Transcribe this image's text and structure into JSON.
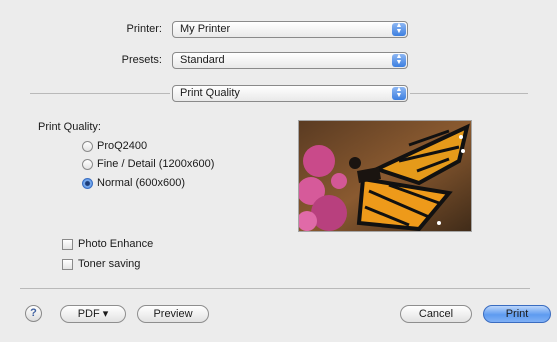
{
  "printer": {
    "label": "Printer:",
    "value": "My Printer"
  },
  "presets": {
    "label": "Presets:",
    "value": "Standard"
  },
  "panel": {
    "value": "Print Quality"
  },
  "print_quality": {
    "heading": "Print Quality:",
    "options": [
      {
        "label": "ProQ2400",
        "selected": false
      },
      {
        "label": "Fine / Detail (1200x600)",
        "selected": false
      },
      {
        "label": "Normal (600x600)",
        "selected": true
      }
    ]
  },
  "checkboxes": [
    {
      "label": "Photo Enhance",
      "checked": false
    },
    {
      "label": "Toner saving",
      "checked": false
    }
  ],
  "buttons": {
    "help": "?",
    "pdf": "PDF ▾",
    "preview": "Preview",
    "cancel": "Cancel",
    "print": "Print"
  },
  "colors": {
    "accent": "#3d7fe0",
    "background": "#ececec"
  }
}
